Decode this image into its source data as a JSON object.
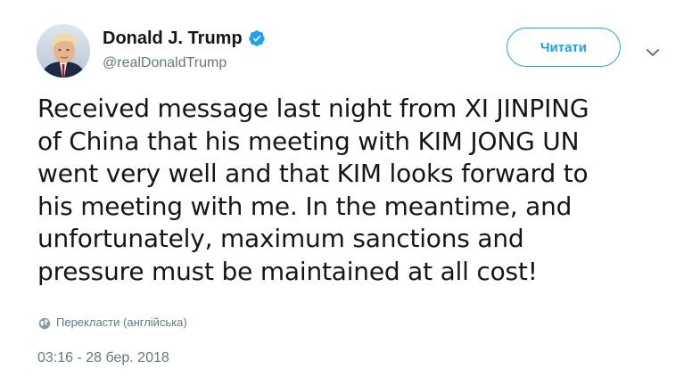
{
  "author": {
    "display_name": "Donald J. Trump",
    "handle": "@realDonaldTrump",
    "verified": true
  },
  "follow_button": {
    "label": "Читати"
  },
  "tweet": {
    "text": "Received message last night from XI JINPING\nof China that his meeting with KIM JONG UN\nwent very well and that KIM looks forward to\nhis meeting with me. In the meantime, and\nunfortunately, maximum sanctions and\npressure must be maintained at all cost!",
    "translate_label": "Перекласти (англійська)",
    "timestamp": "03:16 - 28 бер. 2018"
  },
  "icons": {
    "verified": "verified-badge-icon",
    "caret": "chevron-down-icon",
    "globe": "globe-icon"
  },
  "colors": {
    "accent": "#1da1f2",
    "text": "#14171a",
    "secondary": "#657786"
  }
}
